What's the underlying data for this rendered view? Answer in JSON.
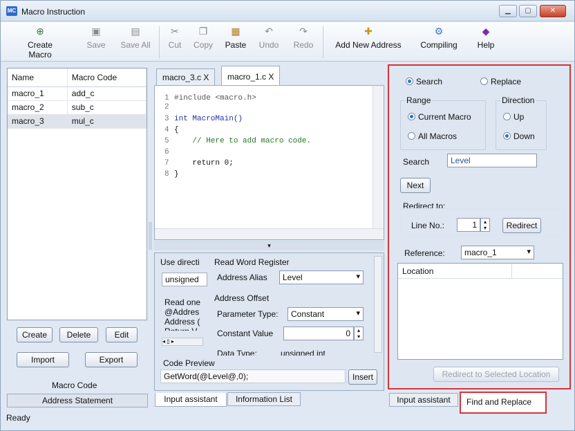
{
  "window": {
    "app_icon": "MC",
    "title": "Macro Instruction"
  },
  "toolbar": {
    "create_macro": "Create Macro",
    "save": "Save",
    "save_all": "Save All",
    "cut": "Cut",
    "copy": "Copy",
    "paste": "Paste",
    "undo": "Undo",
    "redo": "Redo",
    "add_new_address": "Add New Address",
    "compiling": "Compiling",
    "help": "Help"
  },
  "macro_list": {
    "headers": [
      "Name",
      "Macro Code"
    ],
    "rows": [
      {
        "name": "macro_1",
        "code": "add_c"
      },
      {
        "name": "macro_2",
        "code": "sub_c"
      },
      {
        "name": "macro_3",
        "code": "mul_c"
      }
    ],
    "selected": "macro_3"
  },
  "left_buttons": {
    "create": "Create",
    "delete": "Delete",
    "edit": "Edit",
    "import": "Import",
    "export": "Export"
  },
  "left_tabs": {
    "macro_code": "Macro Code",
    "address_statement": "Address Statement"
  },
  "editor": {
    "tabs": [
      {
        "label": "macro_3.c X"
      },
      {
        "label": "macro_1.c X"
      }
    ],
    "active_tab": "macro_1.c X",
    "lines": [
      {
        "n": "1",
        "text": "#include <macro.h>"
      },
      {
        "n": "2",
        "text": ""
      },
      {
        "n": "3",
        "text": "int MacroMain()"
      },
      {
        "n": "4",
        "text": "{"
      },
      {
        "n": "5",
        "text": "    // Here to add macro code."
      },
      {
        "n": "6",
        "text": ""
      },
      {
        "n": "7",
        "text": "    return 0;"
      },
      {
        "n": "8",
        "text": "}"
      }
    ]
  },
  "assistant": {
    "use_direction": "Use directi",
    "type_value": "unsigned",
    "read_text": [
      "Read one",
      "@Addres",
      "Address (",
      "Return V..."
    ],
    "group_title": "Read Word Register",
    "address_alias_label": "Address Alias",
    "address_alias_value": "Level",
    "address_offset_title": "Address Offset",
    "parameter_type_label": "Parameter Type:",
    "parameter_type_value": "Constant",
    "constant_value_label": "Constant Value",
    "constant_value": "0",
    "data_type_label": "Data Type:",
    "data_type_value": "unsigned int",
    "code_preview_title": "Code Preview",
    "code_preview_value": "GetWord(@Level@,0);",
    "insert": "Insert",
    "tabs": {
      "input_assistant": "Input assistant",
      "information_list": "Information List"
    }
  },
  "find": {
    "mode_search": "Search",
    "mode_replace": "Replace",
    "mode_selected": "Search",
    "range_title": "Range",
    "range_current": "Current Macro",
    "range_all": "All Macros",
    "range_selected": "Current Macro",
    "direction_title": "Direction",
    "dir_up": "Up",
    "dir_down": "Down",
    "dir_selected": "Down",
    "search_label": "Search",
    "search_value": "Level",
    "next": "Next",
    "redirect_title": "Redirect to:",
    "line_no_label": "Line No.:",
    "line_no_value": "1",
    "redirect": "Redirect",
    "reference_label": "Reference:",
    "reference_value": "macro_1",
    "location_header": "Location",
    "redirect_selected": "Redirect to Selected Location",
    "tabs": {
      "input_assistant": "Input assistant",
      "find_replace": "Find and Replace"
    },
    "accent_color": "#d8333a"
  },
  "status": {
    "text": "Ready"
  }
}
